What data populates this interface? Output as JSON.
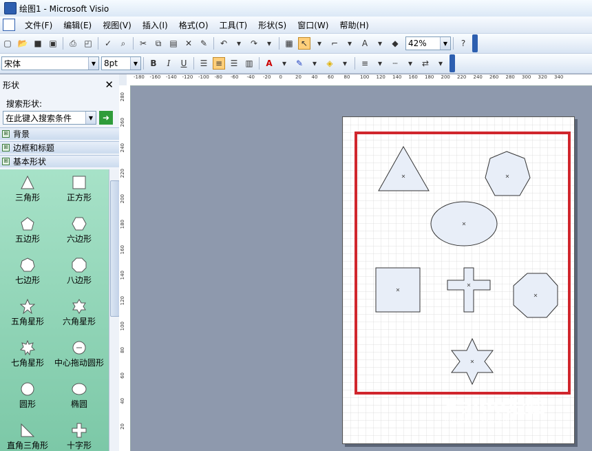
{
  "window": {
    "title": "绘图1 - Microsoft Visio"
  },
  "menu": [
    "文件(F)",
    "编辑(E)",
    "视图(V)",
    "插入(I)",
    "格式(O)",
    "工具(T)",
    "形状(S)",
    "窗口(W)",
    "帮助(H)"
  ],
  "toolbar": {
    "zoom": "42%"
  },
  "format_bar": {
    "font": "宋体",
    "size": "8pt",
    "bold": "B",
    "italic": "I",
    "underline": "U",
    "text_tool": "A"
  },
  "shapes_panel": {
    "title": "形状",
    "search_label": "搜索形状:",
    "search_value": "在此键入搜索条件",
    "go_arrow": "➜",
    "stencils": [
      "背景",
      "边框和标题",
      "基本形状"
    ],
    "items": [
      "三角形",
      "正方形",
      "五边形",
      "六边形",
      "七边形",
      "八边形",
      "五角星形",
      "六角星形",
      "七角星形",
      "中心拖动圆形",
      "圆形",
      "椭圆",
      "直角三角形",
      "十字形"
    ]
  },
  "ruler": {
    "h": [
      "-180",
      "-160",
      "-140",
      "-120",
      "-100",
      "-80",
      "-60",
      "-40",
      "-20",
      "0",
      "20",
      "40",
      "60",
      "80",
      "100",
      "120",
      "140",
      "160",
      "180",
      "200",
      "220",
      "240",
      "260",
      "280",
      "300",
      "320",
      "340"
    ],
    "v": [
      "280",
      "260",
      "240",
      "220",
      "200",
      "180",
      "160",
      "140",
      "120",
      "100",
      "80",
      "60",
      "40",
      "20"
    ]
  },
  "watermark": {
    "text": "Baidu经验",
    "sub": "jingyan.baidu.com"
  },
  "colors": {
    "highlight_border": "#d0262d",
    "shape_fill": "#e8eef8"
  }
}
